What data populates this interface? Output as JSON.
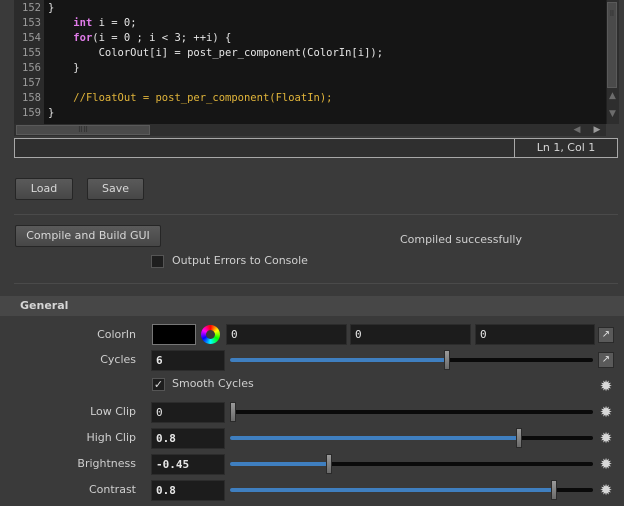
{
  "editor": {
    "lines": [
      {
        "num": "152",
        "code": "}"
      },
      {
        "num": "153",
        "code": "    int i = 0;"
      },
      {
        "num": "154",
        "code": "    for(i = 0 ; i < 3; ++i) {"
      },
      {
        "num": "155",
        "code": "        ColorOut[i] = post_per_component(ColorIn[i]);"
      },
      {
        "num": "156",
        "code": "    }"
      },
      {
        "num": "157",
        "code": ""
      },
      {
        "num": "158",
        "code": "    //FloatOut = post_per_component(FloatIn);"
      },
      {
        "num": "159",
        "code": "}"
      }
    ],
    "status_message": "",
    "cursor_position": "Ln 1, Col 1"
  },
  "buttons": {
    "load": "Load",
    "save": "Save",
    "compile": "Compile and Build GUI"
  },
  "compile_status": "Compiled successfully",
  "output_errors": {
    "label": "Output Errors to Console",
    "checked": false
  },
  "section": {
    "title": "General"
  },
  "params": {
    "colorin": {
      "label": "ColorIn",
      "swatch": "#000000",
      "values": [
        "0",
        "0",
        "0"
      ]
    },
    "cycles": {
      "label": "Cycles",
      "value": "6",
      "slider_fraction": 0.6
    },
    "smooth_cycles": {
      "label": "Smooth Cycles",
      "checked": true
    },
    "low_clip": {
      "label": "Low Clip",
      "value": "0",
      "slider_fraction": 0.0
    },
    "high_clip": {
      "label": "High Clip",
      "value": "0.8",
      "slider_fraction": 0.8
    },
    "brightness": {
      "label": "Brightness",
      "value": "-0.45",
      "slider_fraction": 0.27
    },
    "contrast": {
      "label": "Contrast",
      "value": "0.8",
      "slider_fraction": 0.9
    }
  },
  "colors": {
    "accent": "#3f7fc0",
    "keyword": "#e07be8",
    "comment": "#e0b43a"
  }
}
